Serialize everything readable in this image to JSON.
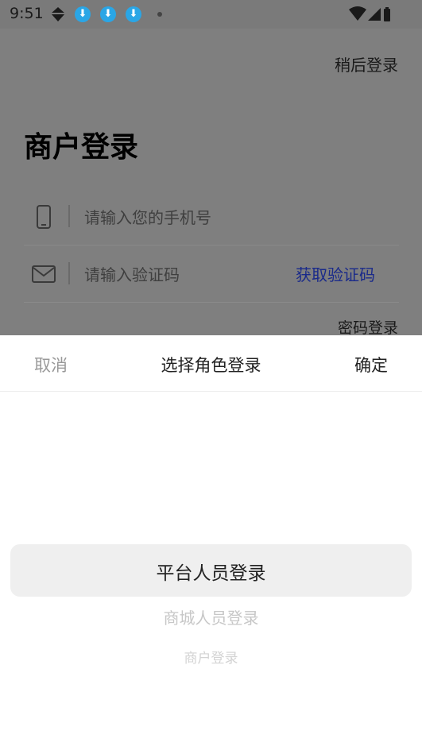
{
  "status_bar": {
    "time": "9:51",
    "icons": [
      "kite-icon",
      "download-icon",
      "download-icon",
      "download-icon",
      "dot-icon",
      "wifi-icon",
      "signal-icon",
      "battery-icon"
    ]
  },
  "login_page": {
    "later_label": "稍后登录",
    "title": "商户登录",
    "phone_placeholder": "请输入您的手机号",
    "code_placeholder": "请输入验证码",
    "get_code_label": "获取验证码",
    "password_login_label": "密码登录"
  },
  "role_sheet": {
    "cancel_label": "取消",
    "title": "选择角色登录",
    "confirm_label": "确定",
    "options": [
      "平台人员登录",
      "商城人员登录",
      "商户登录"
    ],
    "selected_index": 0
  },
  "colors": {
    "overlay_gray": "#7f7f7f",
    "link_blue": "#1a2a8a",
    "download_badge": "#2aa6e6"
  }
}
